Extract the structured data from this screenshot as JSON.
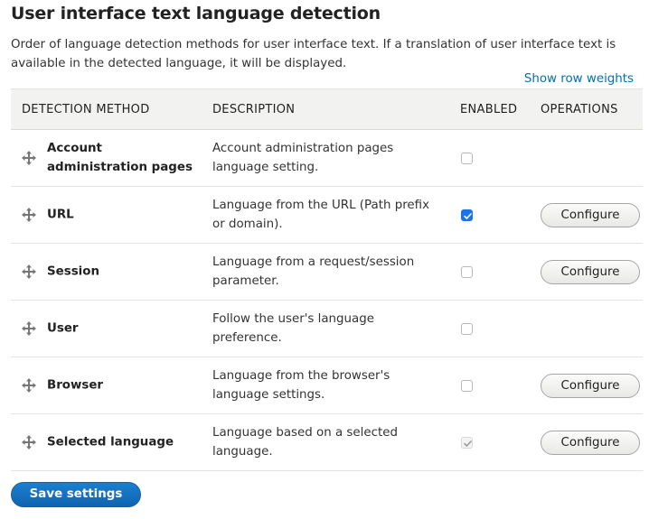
{
  "page": {
    "title": "User interface text language detection",
    "description": "Order of language detection methods for user interface text. If a translation of user interface text is available in the detected language, it will be displayed.",
    "show_weights_label": "Show row weights"
  },
  "table": {
    "headers": {
      "method": "Detection method",
      "description": "Description",
      "enabled": "Enabled",
      "operations": "Operations"
    },
    "rows": [
      {
        "method": "Account administration pages",
        "description": "Account administration pages language setting.",
        "enabled": false,
        "locked": false,
        "operation": ""
      },
      {
        "method": "URL",
        "description": "Language from the URL (Path prefix or domain).",
        "enabled": true,
        "locked": false,
        "operation": "Configure"
      },
      {
        "method": "Session",
        "description": "Language from a request/session parameter.",
        "enabled": false,
        "locked": false,
        "operation": "Configure"
      },
      {
        "method": "User",
        "description": "Follow the user's language preference.",
        "enabled": false,
        "locked": false,
        "operation": ""
      },
      {
        "method": "Browser",
        "description": "Language from the browser's language settings.",
        "enabled": false,
        "locked": false,
        "operation": "Configure"
      },
      {
        "method": "Selected language",
        "description": "Language based on a selected language.",
        "enabled": true,
        "locked": true,
        "operation": "Configure"
      }
    ]
  },
  "actions": {
    "save_label": "Save settings"
  },
  "colors": {
    "link": "#0071b3",
    "checkbox_checked": "#1a73e8",
    "primary_button": "#1170c0"
  },
  "icons": {
    "drag": "move-arrows-icon",
    "check": "checkmark-icon"
  }
}
